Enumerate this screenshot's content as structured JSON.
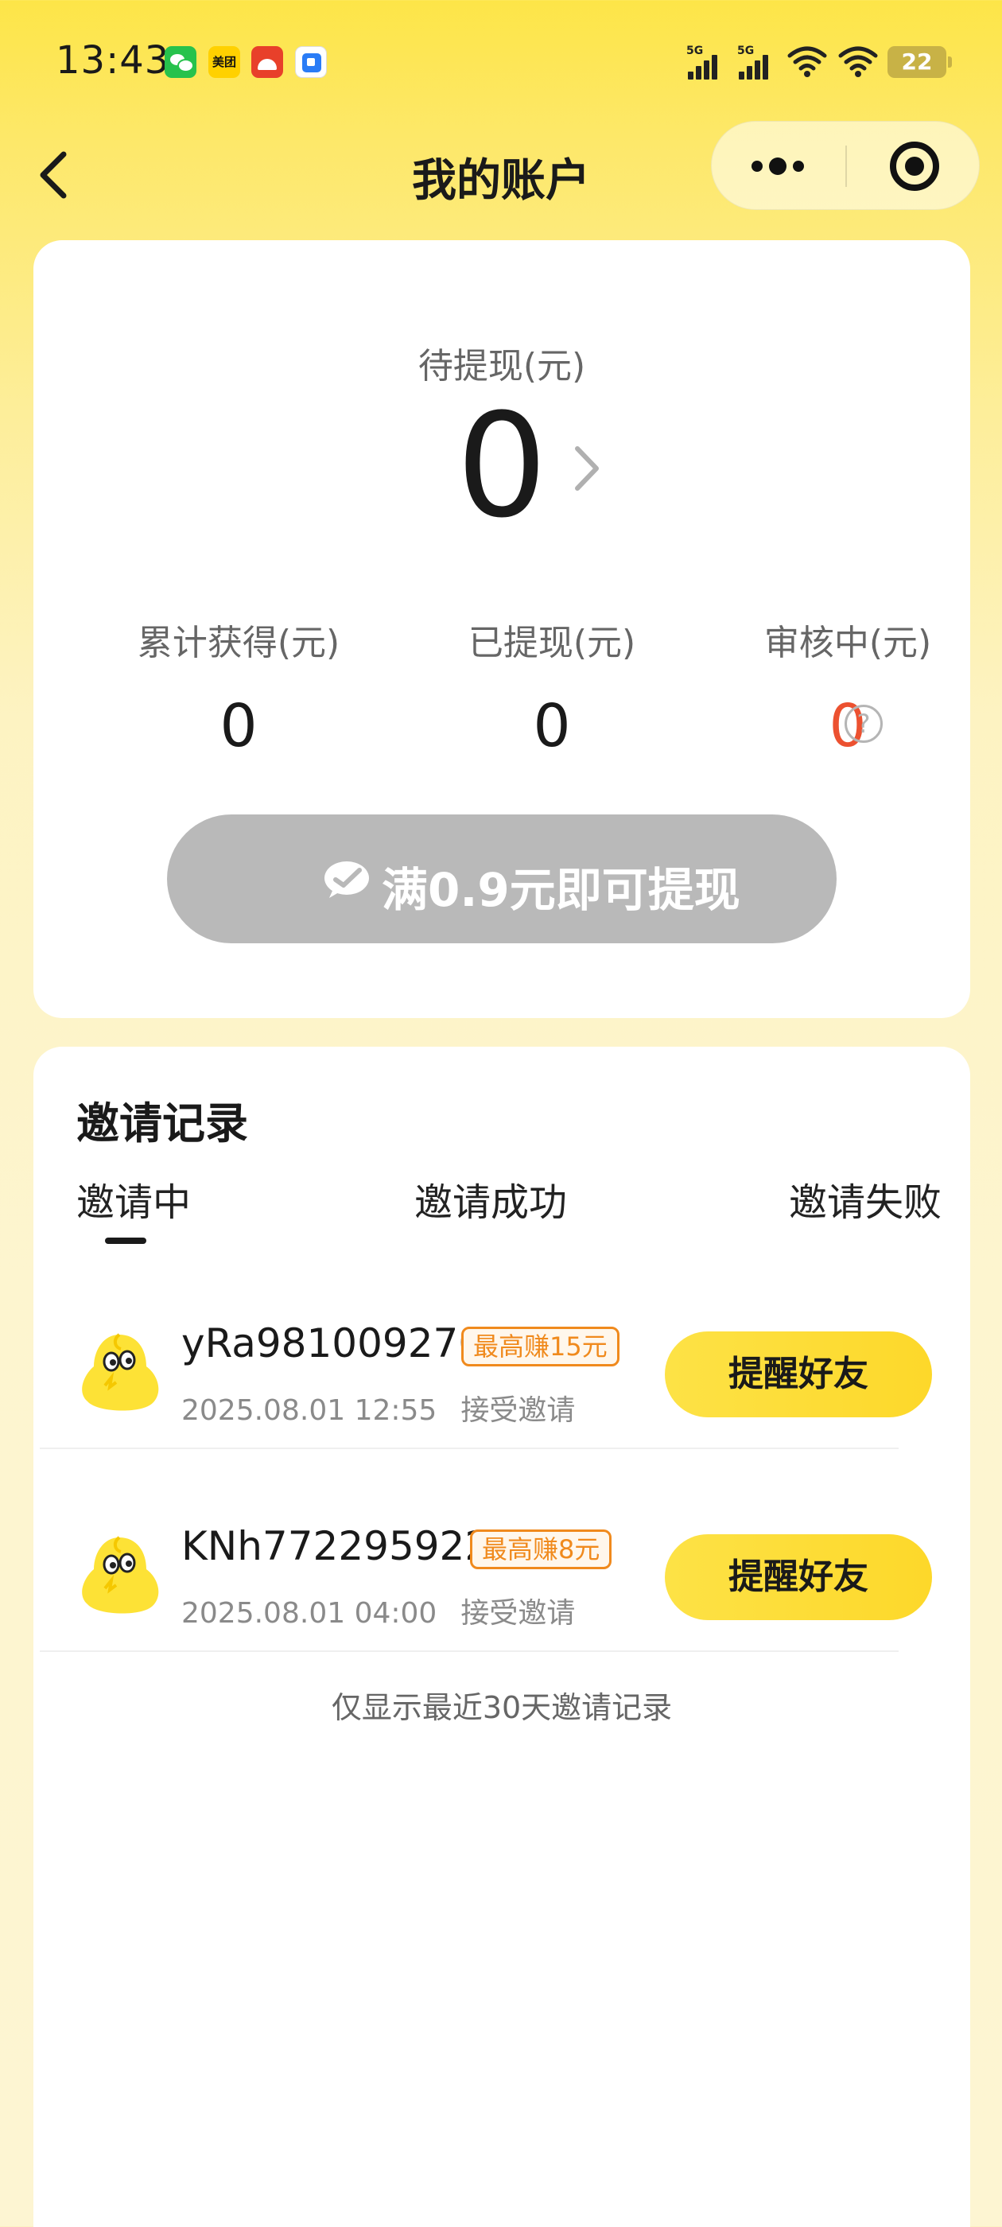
{
  "status_bar": {
    "time": "13:43",
    "apps": [
      "wechat-icon",
      "meituan-icon",
      "app-icon",
      "app-icon"
    ],
    "meituan_label": "美团",
    "signal_labels": [
      "5G",
      "5G"
    ],
    "battery": "22"
  },
  "nav": {
    "title": "我的账户",
    "back_icon": "chevron-left-icon",
    "more_icon": "more-dots-icon",
    "close_icon": "target-close-icon"
  },
  "account": {
    "pending_label": "待提现(元)",
    "pending_value": "0",
    "stats": [
      {
        "label": "累计获得(元)",
        "value": "0"
      },
      {
        "label": "已提现(元)",
        "value": "0"
      },
      {
        "label": "审核中(元)",
        "value": "0"
      }
    ],
    "help_glyph": "?",
    "withdraw_button": "满0.9元即可提现"
  },
  "invite": {
    "title": "邀请记录",
    "tabs": [
      "邀请中",
      "邀请成功",
      "邀请失败"
    ],
    "records": [
      {
        "username": "yRa981009270",
        "badge": "最高赚15元",
        "date": "2025.08.01 12:55",
        "status": "接受邀请",
        "button": "提醒好友"
      },
      {
        "username": "KNh772295922",
        "badge": "最高赚8元",
        "date": "2025.08.01 04:00",
        "status": "接受邀请",
        "button": "提醒好友"
      }
    ],
    "footer_note": "仅显示最近30天邀请记录"
  },
  "colors": {
    "accent_yellow": "#fde246",
    "review_red": "#ec5130",
    "badge_orange": "#f08a1d",
    "disabled_gray": "#b9b9b9"
  }
}
